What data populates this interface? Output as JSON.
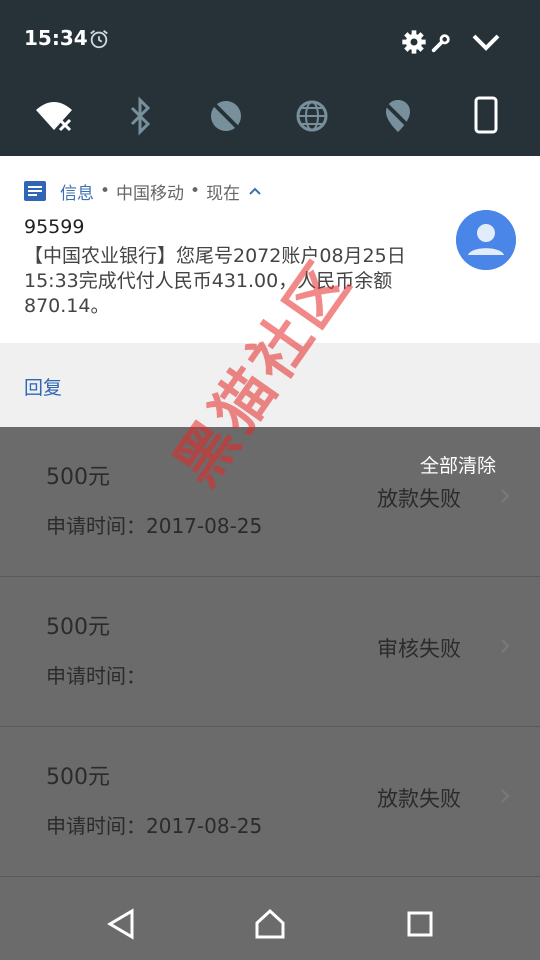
{
  "status_bar": {
    "time": "15:34"
  },
  "quick_settings": {
    "tiles": [
      "wifi-off-icon",
      "bluetooth-icon",
      "data-saver-icon",
      "globe-icon",
      "location-off-icon",
      "phone-icon"
    ]
  },
  "notification": {
    "app_name": "信息",
    "separator": "•",
    "sub_text": "中国移动",
    "time": "现在",
    "sender": "95599",
    "message": "【中国农业银行】您尾号2072账户08月25日15:33完成代付人民币431.00，人民币余额870.14。",
    "action_reply": "回复"
  },
  "clear_all": "全部清除",
  "list": {
    "items": [
      {
        "amount": "500元",
        "date": "申请时间：2017-08-25",
        "status": "放款失败"
      },
      {
        "amount": "500元",
        "date": "申请时间：",
        "status": "审核失败"
      },
      {
        "amount": "500元",
        "date": "申请时间：2017-08-25",
        "status": "放款失败"
      }
    ]
  },
  "watermark": "黑猫社区",
  "colors": {
    "shade": "#263238",
    "accent": "#3e6fb2",
    "avatar": "#4a86e8",
    "watermark": "#e62828"
  }
}
